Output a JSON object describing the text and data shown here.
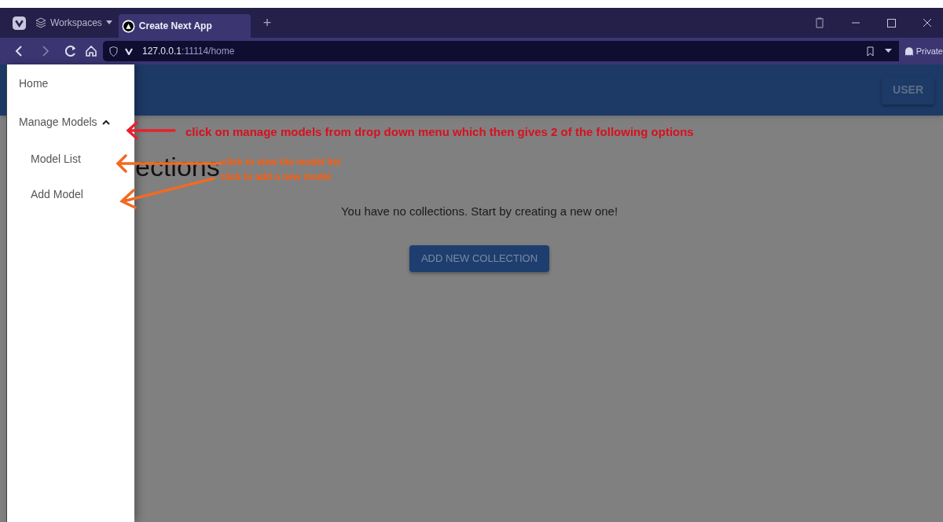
{
  "browser": {
    "workspaces_label": "Workspaces",
    "tabs": [
      {
        "title": "Create Next App",
        "selected": true
      }
    ],
    "new_tab": "+",
    "address": {
      "host": "127.0.0.1",
      "rest": ":11114/home"
    },
    "private_label": "Private"
  },
  "app_bar": {
    "user_button": "USER"
  },
  "page": {
    "heading": "ections",
    "empty_message": "You have no collections. Start by creating a new one!",
    "add_button": "ADD NEW COLLECTION"
  },
  "drawer": {
    "items": [
      {
        "label": "Home"
      },
      {
        "label": "Manage Models",
        "expanded": true,
        "children": [
          {
            "label": "Model List"
          },
          {
            "label": "Add Model"
          }
        ]
      }
    ]
  },
  "annotations": [
    {
      "kind": "red",
      "text": "click on manage models from drop down menu which then gives 2 of the following options"
    },
    {
      "kind": "orange",
      "text": "click to view the model list"
    },
    {
      "kind": "orange",
      "text": "click to add a new model"
    }
  ]
}
